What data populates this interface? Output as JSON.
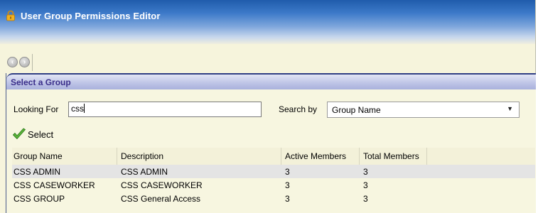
{
  "window": {
    "title": "User Group Permissions Editor",
    "title_icon": "lock-icon"
  },
  "nav": {
    "back_icon": "back-arrow-icon",
    "forward_icon": "forward-arrow-icon"
  },
  "panel": {
    "title": "Select a Group"
  },
  "search": {
    "looking_for_label": "Looking For",
    "looking_for_value": "css",
    "search_by_label": "Search by",
    "search_by_value": "Group Name"
  },
  "actions": {
    "select_label": "Select",
    "select_icon": "checkmark-icon"
  },
  "table": {
    "columns": [
      "Group Name",
      "Description",
      "Active Members",
      "Total Members"
    ],
    "rows": [
      [
        "CSS ADMIN",
        "CSS ADMIN",
        "3",
        "3"
      ],
      [
        "CSS CASEWORKER",
        "CSS CASEWORKER",
        "3",
        "3"
      ],
      [
        "CSS GROUP",
        "CSS General Access",
        "3",
        "3"
      ]
    ]
  },
  "colors": {
    "title_bar": "#1f5cab",
    "panel_header": "#bfc5e7",
    "panel_title_text": "#3a2e8a",
    "background": "#f6f4dc",
    "selected_row": "#e4e4e4"
  }
}
